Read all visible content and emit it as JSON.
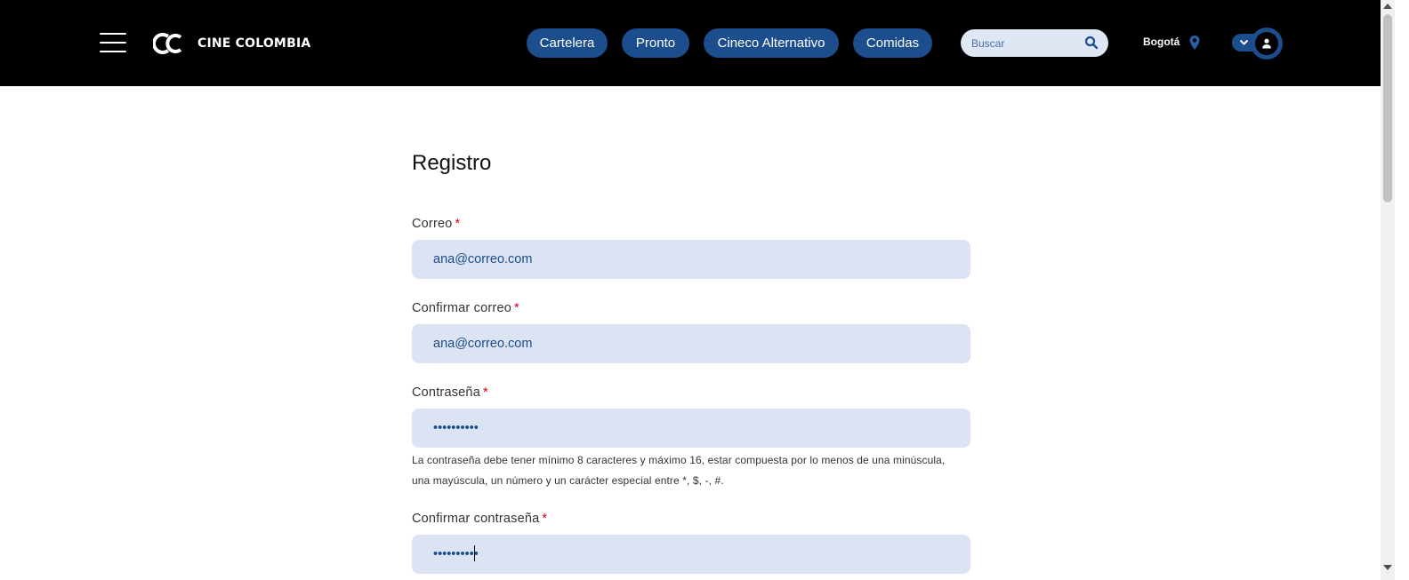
{
  "header": {
    "brand": "CINE COLOMBIA",
    "nav": [
      {
        "label": "Cartelera"
      },
      {
        "label": "Pronto"
      },
      {
        "label": "Cineco Alternativo"
      },
      {
        "label": "Comidas"
      }
    ],
    "search": {
      "placeholder": "Buscar"
    },
    "city": "Bogotá"
  },
  "form": {
    "title": "Registro",
    "email": {
      "label": "Correo",
      "required": "*",
      "value": "ana@correo.com"
    },
    "confirm_email": {
      "label": "Confirmar correo",
      "required": "*",
      "value": "ana@correo.com"
    },
    "password": {
      "label": "Contraseña",
      "required": "*",
      "value": "••••••••••"
    },
    "password_hint_1": "La contraseña debe tener mínimo 8 caracteres y máximo 16, estar compuesta por lo menos de una minúscula,",
    "password_hint_2": "una mayúscula, un número y un carácter especial entre *, $, -, #.",
    "confirm_password": {
      "label": "Confirmar contraseña",
      "required": "*",
      "value": "••••••••••"
    }
  },
  "colors": {
    "header_bg": "#000000",
    "accent": "#1c4d8c",
    "field_bg": "#dce3f3",
    "required": "#d0021b"
  },
  "icons": [
    "hamburger-icon",
    "search-icon",
    "location-pin-icon",
    "chevron-down-icon",
    "user-icon"
  ]
}
